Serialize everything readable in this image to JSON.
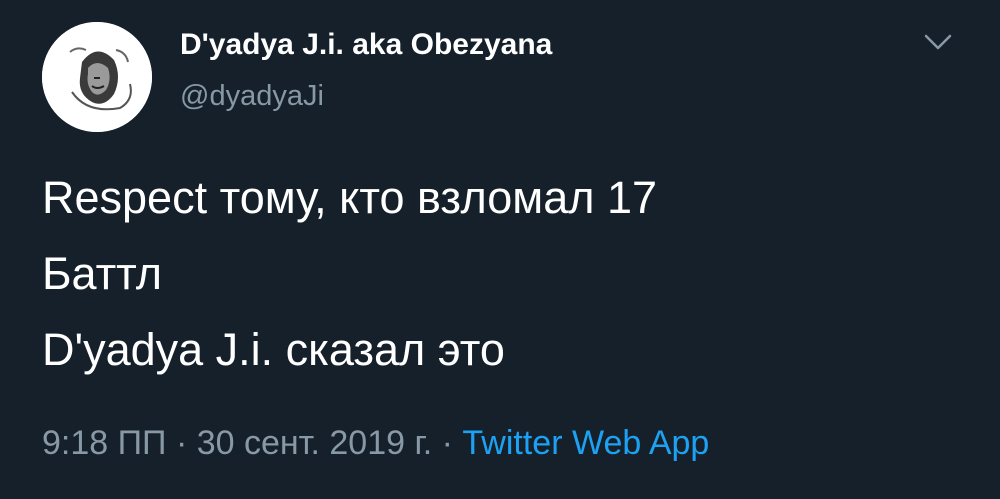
{
  "tweet": {
    "author": {
      "display_name": "D'yadya J.i. aka Obezyana",
      "handle": "@dyadyaJi"
    },
    "text_lines": [
      "Respect тому, кто взломал 17",
      "Баттл",
      "D'yadya J.i. сказал это"
    ],
    "time": "9:18 ПП",
    "separator": "·",
    "date": "30 сент. 2019 г.",
    "source": "Twitter Web App"
  },
  "icons": {
    "menu": "chevron-down-icon",
    "avatar": "avatar"
  },
  "colors": {
    "background": "#15202b",
    "primary_text": "#ffffff",
    "secondary_text": "#8899a6",
    "link": "#1da1f2"
  }
}
